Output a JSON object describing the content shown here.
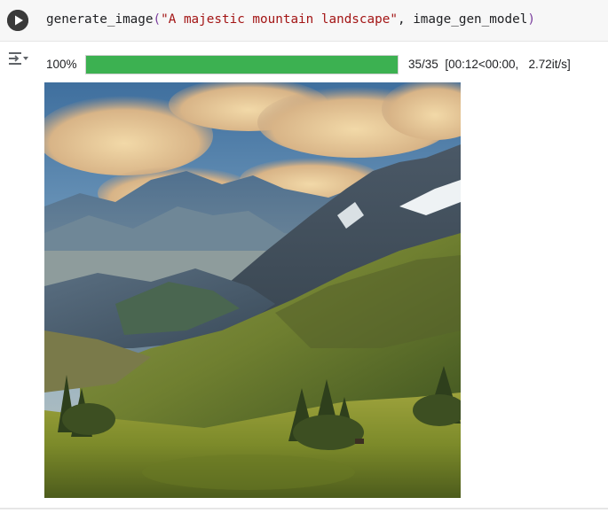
{
  "cell": {
    "code": {
      "function_name": "generate_image",
      "open_paren": "(",
      "prompt_string": "\"A majestic mountain landscape\"",
      "separator": ", ",
      "argument": "image_gen_model",
      "close_paren": ")"
    },
    "run_button_icon": "play-icon",
    "output_toggle_icon": "output-collapse-icon"
  },
  "progress": {
    "percent_label": "100%",
    "fraction": 1.0,
    "steps": "35/35",
    "timing": "[00:12<00:00,",
    "rate": "2.72it/s]",
    "bar_color": "#3cb151"
  },
  "output_image": {
    "description_icon": "generated-mountain-landscape-image"
  }
}
